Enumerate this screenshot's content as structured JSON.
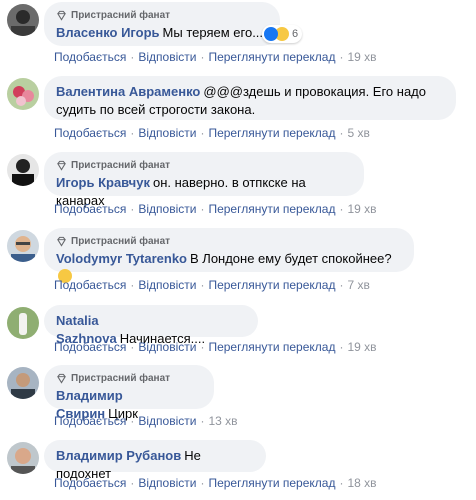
{
  "badge_label": "Пристрасний фанат",
  "actions": {
    "like": "Подобається",
    "reply": "Відповісти",
    "translate": "Переглянути переклад"
  },
  "comments": [
    {
      "author": "Власенко Игорь",
      "text": "Мы теряем его...",
      "time": "19 хв",
      "reactions": "6"
    },
    {
      "author": "Валентина Авраменко",
      "text": "@@@здешь и провокация. Его надо судить по всей строгости закона.",
      "time": "5 хв"
    },
    {
      "author": "Игорь Кравчук",
      "text": "он. наверно. в отпкске на канарах",
      "time": "19 хв"
    },
    {
      "author": "Volodymyr Tytarenko",
      "text": "В Лондоне ему будет спокойнее?",
      "time": "7 хв"
    },
    {
      "author": "Natalia Sazhnova",
      "text": "Начинается....",
      "time": "19 хв"
    },
    {
      "author": "Владимир Свирин",
      "text": "Цирк",
      "time": "13 хв"
    },
    {
      "author": "Владимир Рубанов",
      "text": "Не подохнет",
      "time": "18 хв"
    }
  ],
  "colors": {
    "author": "#385898",
    "bubble": "#f0f2f5",
    "meta": "#90949c"
  }
}
